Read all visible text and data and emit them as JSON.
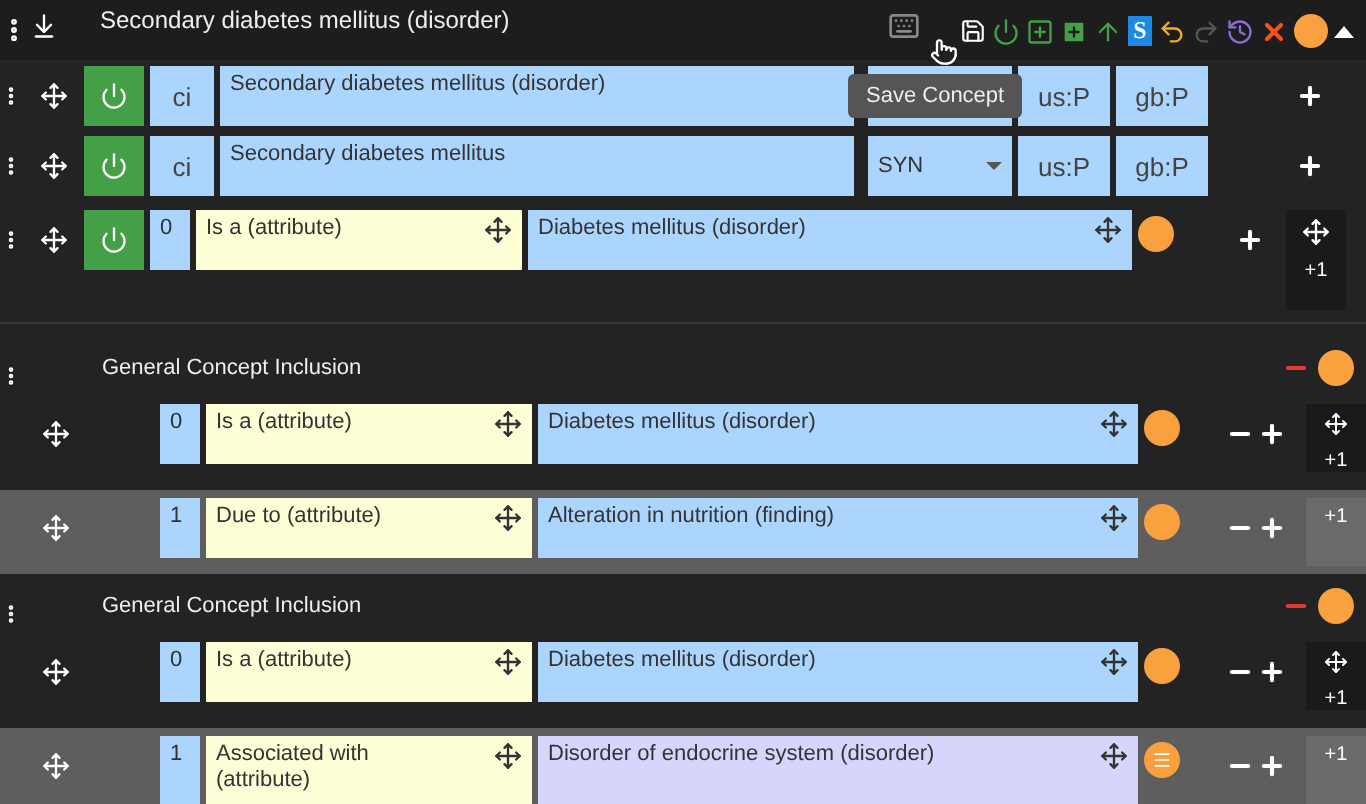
{
  "header": {
    "title": "Secondary diabetes mellitus (disorder)",
    "badge_text": "S",
    "toolbar": [
      {
        "kind": "save",
        "disabled": false
      },
      {
        "kind": "power",
        "disabled": false
      },
      {
        "kind": "add-outline",
        "disabled": false
      },
      {
        "kind": "add",
        "disabled": false
      },
      {
        "kind": "promote",
        "disabled": false
      },
      {
        "kind": "badge",
        "disabled": false
      },
      {
        "kind": "undo",
        "disabled": false
      },
      {
        "kind": "redo",
        "disabled": true
      },
      {
        "kind": "history",
        "disabled": false
      },
      {
        "kind": "close",
        "disabled": false
      }
    ],
    "expanded": true
  },
  "tooltip": {
    "text": "Save Concept"
  },
  "descriptions": [
    {
      "active": true,
      "case": "ci",
      "term": "Secondary diabetes mellitus (disorder)",
      "us": "us:P",
      "gb": "gb:P"
    },
    {
      "active": true,
      "case": "ci",
      "term": "Secondary diabetes mellitus",
      "type": "SYN",
      "us": "us:P",
      "gb": "gb:P"
    }
  ],
  "relationships": [
    {
      "active": true,
      "group": "0",
      "type": "Is a (attribute)",
      "target": "Diabetes mellitus (disorder)",
      "fully_defined": false,
      "menu_dot": false,
      "side_move": true,
      "side_label": "+1"
    }
  ],
  "gcis": [
    {
      "title": "General Concept Inclusion",
      "rows": [
        {
          "group": "0",
          "type": "Is a (attribute)",
          "target": "Diabetes mellitus (disorder)",
          "fully_defined": false,
          "menu_dot": false,
          "highlighted": false,
          "side_move": true,
          "side_label": "+1"
        },
        {
          "group": "1",
          "type": "Due to (attribute)",
          "target": "Alteration in nutrition (finding)",
          "fully_defined": false,
          "menu_dot": false,
          "highlighted": true,
          "side_move": false,
          "side_label": "+1"
        }
      ]
    },
    {
      "title": "General Concept Inclusion",
      "rows": [
        {
          "group": "0",
          "type": "Is a (attribute)",
          "target": "Diabetes mellitus (disorder)",
          "fully_defined": false,
          "menu_dot": false,
          "highlighted": false,
          "side_move": true,
          "side_label": "+1"
        },
        {
          "group": "1",
          "type": "Associated with (attribute)",
          "target": "Disorder of endocrine system (disorder)",
          "fully_defined": true,
          "menu_dot": true,
          "highlighted": true,
          "side_move": false,
          "side_label": "+1"
        }
      ]
    }
  ]
}
